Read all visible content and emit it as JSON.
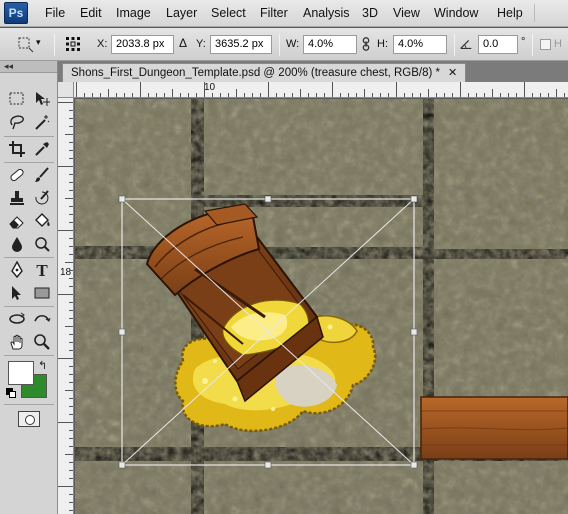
{
  "app": {
    "logo": "Ps"
  },
  "menu": [
    "File",
    "Edit",
    "Image",
    "Layer",
    "Select",
    "Filter",
    "Analysis",
    "3D",
    "View",
    "Window",
    "Help"
  ],
  "options": {
    "x_label": "X:",
    "x_value": "2033.8 px",
    "delta_label": "Δ",
    "y_label": "Y:",
    "y_value": "3635.2 px",
    "w_label": "W:",
    "w_value": "4.0%",
    "h_label": "H:",
    "h_value": "4.0%",
    "angle_value": "0.0",
    "degree_symbol": "°"
  },
  "document": {
    "tab_title": "Shons_First_Dungeon_Template.psd @ 200% (treasure chest, RGB/8) *",
    "close_glyph": "✕"
  },
  "rulers": {
    "top_label": "10",
    "left_label": "18"
  },
  "toolbox": {
    "header": "◂◂",
    "foreground_color": "#ffffff",
    "background_color": "#2f8a2b",
    "tools": [
      "marquee-icon",
      "move-icon",
      "lasso-icon",
      "magic-wand-icon",
      "crop-icon",
      "eyedropper-icon",
      "healing-brush-icon",
      "brush-icon",
      "clone-stamp-icon",
      "history-brush-icon",
      "eraser-icon",
      "paint-bucket-icon",
      "blur-icon",
      "dodge-icon",
      "pen-icon",
      "type-icon",
      "path-selection-icon",
      "rectangle-shape-icon",
      "3d-rotate-icon",
      "3d-orbit-icon",
      "hand-icon",
      "zoom-icon"
    ]
  }
}
